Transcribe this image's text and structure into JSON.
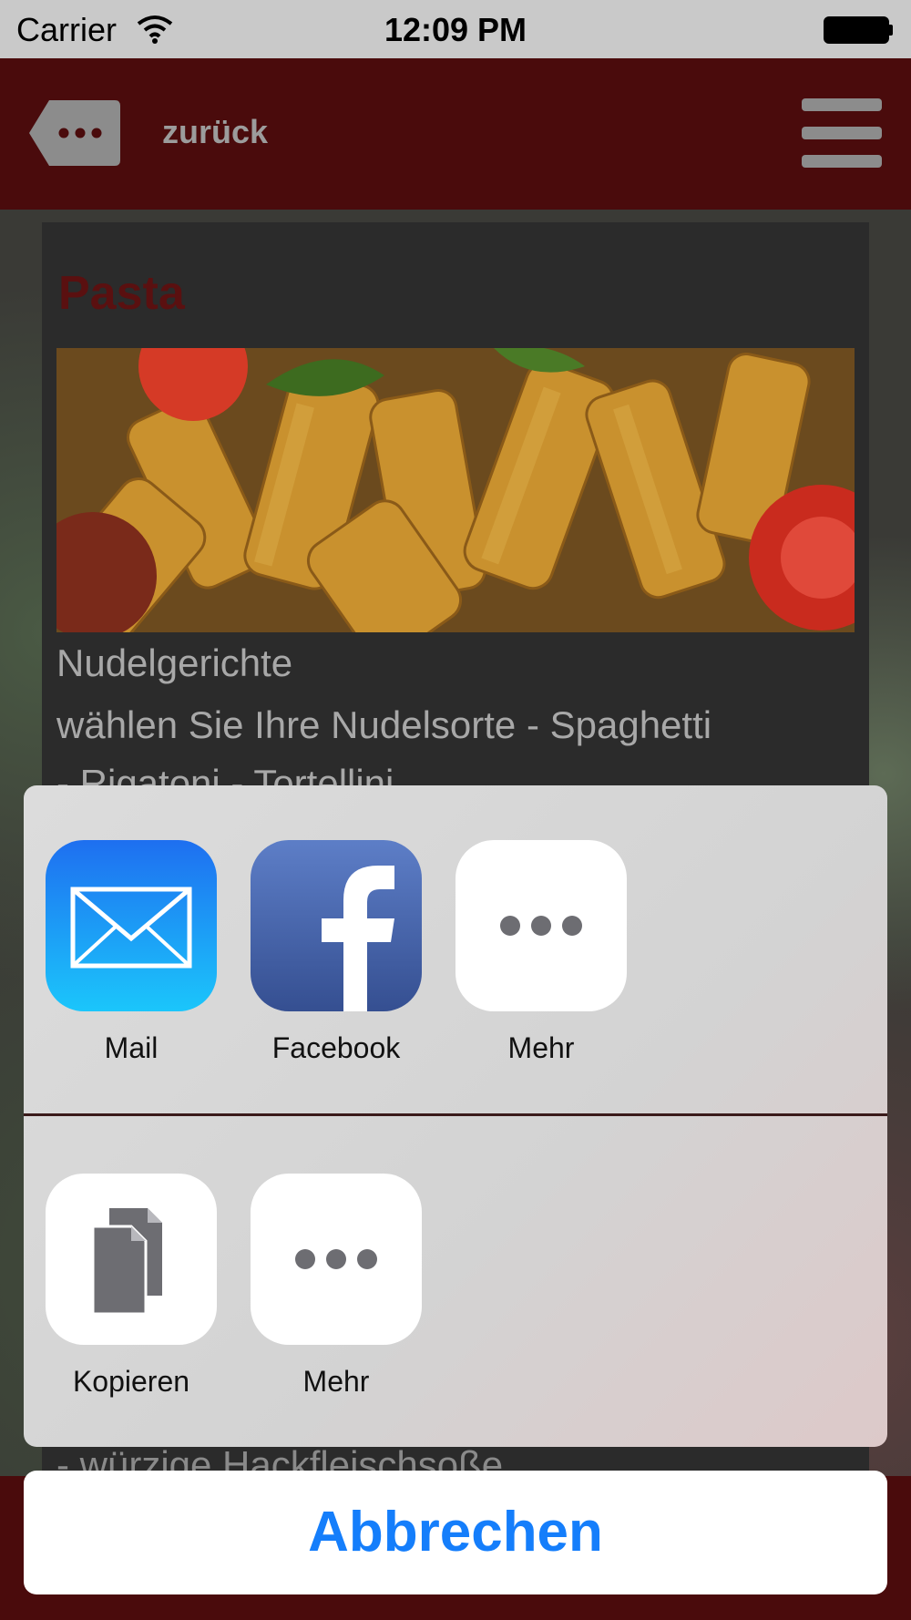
{
  "status_bar": {
    "carrier": "Carrier",
    "time": "12:09 PM"
  },
  "nav": {
    "back_label": "zurück",
    "back_icon": "ellipsis-tag-icon",
    "menu_icon": "hamburger-menu-icon"
  },
  "content": {
    "title": "Pasta",
    "desc_line1": "Nudelgerichte",
    "desc_line2": "wählen Sie Ihre Nudelsorte - Spaghetti",
    "desc_line3": "- Rigatoni - Tortellini",
    "desc_line4": "- würzige Hackfleischsoße"
  },
  "share_sheet": {
    "row1": [
      {
        "label": "Mail",
        "icon": "mail-icon"
      },
      {
        "label": "Facebook",
        "icon": "facebook-icon"
      },
      {
        "label": "Mehr",
        "icon": "more-icon"
      }
    ],
    "row2": [
      {
        "label": "Kopieren",
        "icon": "copy-icon"
      },
      {
        "label": "Mehr",
        "icon": "more-icon"
      }
    ],
    "cancel_label": "Abbrechen"
  },
  "colors": {
    "nav_background": "#4a0b0c",
    "cancel_text": "#157efb"
  }
}
